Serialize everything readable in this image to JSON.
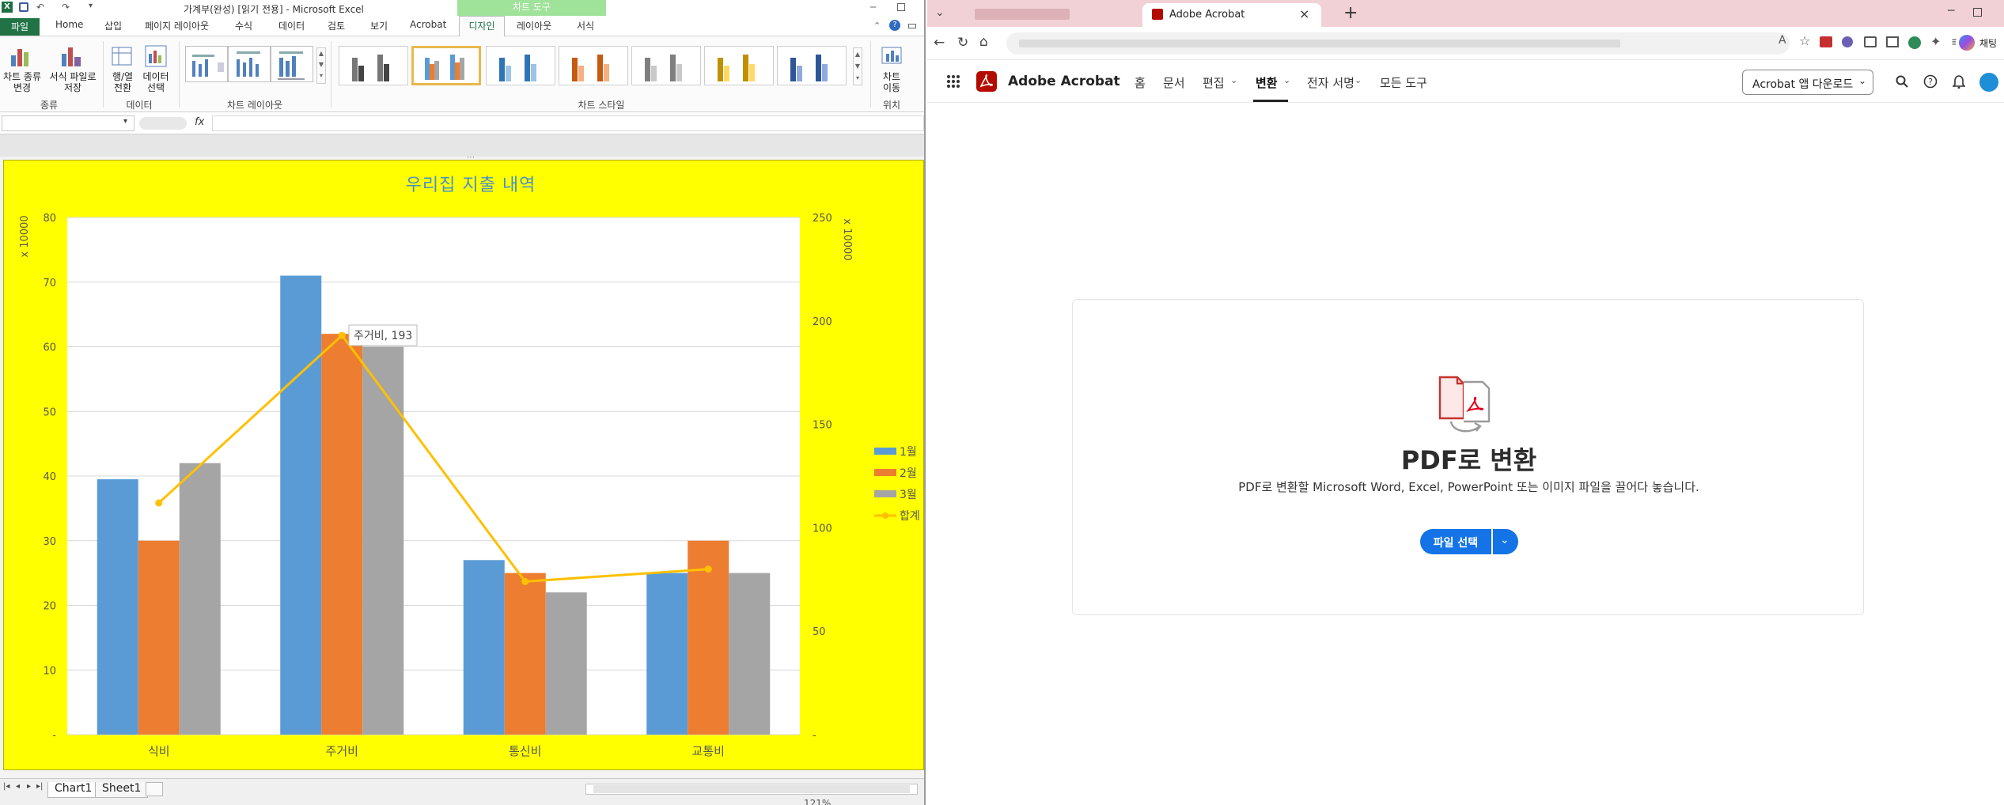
{
  "excel": {
    "title": "가계부(완성)  [읽기 전용]  -  Microsoft Excel",
    "context_tab_label": "차트 도구",
    "tabs": [
      "파일",
      "Home",
      "삽입",
      "페이지 레이아웃",
      "수식",
      "데이터",
      "검토",
      "보기",
      "Acrobat",
      "디자인",
      "레이아웃",
      "서식"
    ],
    "active_tab": "디자인",
    "ribbon": {
      "btn_change_type": "차트 종류\n변경",
      "btn_save_template": "서식 파일로\n저장",
      "btn_switch": "행/열\n전환",
      "btn_select_data": "데이터\n선택",
      "btn_move_chart": "차트\n이동",
      "group_type": "종류",
      "group_data": "데이터",
      "group_layouts": "차트 레이아웃",
      "group_styles": "차트 스타일",
      "group_location": "위치"
    },
    "formula_fx": "fx",
    "sheet_tabs": [
      "Chart1",
      "Sheet1"
    ],
    "zoom": "121%"
  },
  "chart_data": {
    "type": "bar",
    "title": "우리집 지출 내역",
    "categories": [
      "식비",
      "주거비",
      "통신비",
      "교통비"
    ],
    "y_unit_left": "x 10000",
    "y_unit_right": "x 10000",
    "ylim_left": [
      0,
      80
    ],
    "yticks_left": [
      "-",
      "10",
      "20",
      "30",
      "40",
      "50",
      "60",
      "70",
      "80"
    ],
    "ylim_right": [
      0,
      250
    ],
    "yticks_right": [
      "-",
      "50",
      "100",
      "150",
      "200",
      "250"
    ],
    "series": [
      {
        "name": "1월",
        "type": "bar",
        "color": "#5b9bd5",
        "values": [
          39.5,
          71,
          27,
          25
        ]
      },
      {
        "name": "2월",
        "type": "bar",
        "color": "#ed7d31",
        "values": [
          30,
          62,
          25,
          30
        ]
      },
      {
        "name": "3월",
        "type": "bar",
        "color": "#a5a5a5",
        "values": [
          42,
          60,
          22,
          25
        ]
      },
      {
        "name": "합계",
        "type": "line",
        "axis": "right",
        "color": "#ffc000",
        "values": [
          112,
          193,
          74,
          80
        ]
      }
    ],
    "data_label": "주거비, 193",
    "legend": "right",
    "grid": true,
    "background": "#ffff00"
  },
  "edge": {
    "tabs": [
      {
        "label": "",
        "active": false
      },
      {
        "label": "Adobe Acrobat",
        "active": true
      }
    ],
    "right_label": "채팅"
  },
  "acrobat": {
    "brand": "Adobe Acrobat",
    "nav": [
      "홈",
      "문서",
      "편집",
      "변환",
      "전자 서명",
      "모든 도구"
    ],
    "active_nav": "변환",
    "download_btn": "Acrobat 앱 다운로드",
    "heading": "PDF로 변환",
    "description": "PDF로 변환할 Microsoft Word, Excel, PowerPoint 또는 이미지 파일을 끌어다 놓습니다.",
    "select_file_btn": "파일 선택",
    "brand_color": "#eb1000",
    "accent_color": "#1473e6"
  }
}
